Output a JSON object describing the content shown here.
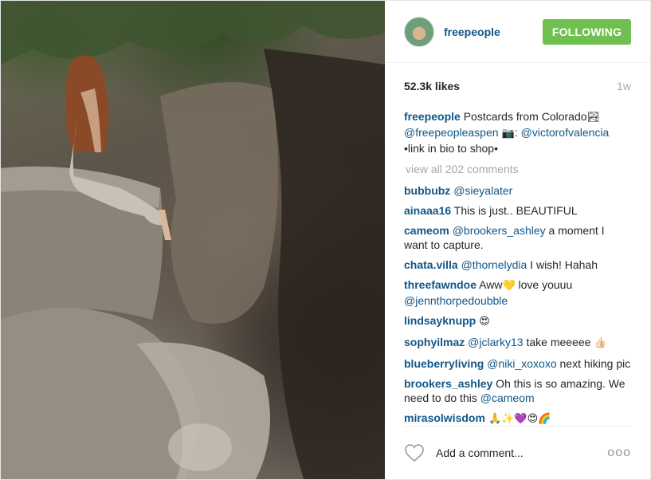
{
  "photo": {
    "alt": "Woman in long dress sitting on rocks above a canyon"
  },
  "header": {
    "username": "freepeople",
    "follow_label": "FOLLOWING",
    "avatar_icon": "profile-avatar"
  },
  "meta": {
    "likes": "52.3k likes",
    "age": "1w"
  },
  "caption": {
    "username": "freepeople",
    "text1": " Postcards from Colorado",
    "emoji1": "🏞",
    "mention1": "@freepeopleaspen",
    "emoji2": " 📷",
    "text2": ": ",
    "mention2": "@victorofvalencia",
    "text3": "•link in bio to shop•"
  },
  "view_all": "view all 202 comments",
  "comments": [
    {
      "user": "bubbubz",
      "mention": "@sieyalater",
      "text": ""
    },
    {
      "user": "ainaaa16",
      "mention": "",
      "text": " This is just.. BEAUTIFUL"
    },
    {
      "user": "cameom",
      "mention": "@brookers_ashley",
      "text": " a moment I want to capture."
    },
    {
      "user": "chata.villa",
      "mention": "@thornelydia",
      "text": " I wish! Hahah"
    },
    {
      "user": "threefawndoe",
      "text_before": " Aww",
      "emoji": "💛",
      "text": " love youuu ",
      "mention": "@jennthorpedoubble"
    },
    {
      "user": "lindsayknupp",
      "mention": "",
      "text": " ",
      "emoji": "😍"
    },
    {
      "user": "sophyilmaz",
      "mention": "@jclarky13",
      "text": " take meeeee ",
      "emoji": "👍🏻"
    },
    {
      "user": "blueberryliving",
      "mention": "@niki_xoxoxo",
      "text": " next hiking pic"
    },
    {
      "user": "brookers_ashley",
      "text_before": " Oh this is so amazing. We need to do this ",
      "mention": "@cameom"
    },
    {
      "user": "mirasolwisdom",
      "emoji": " 🙏✨💜😍🌈"
    }
  ],
  "footer": {
    "placeholder": "Add a comment...",
    "more": "ooo",
    "heart_icon": "heart-icon"
  }
}
